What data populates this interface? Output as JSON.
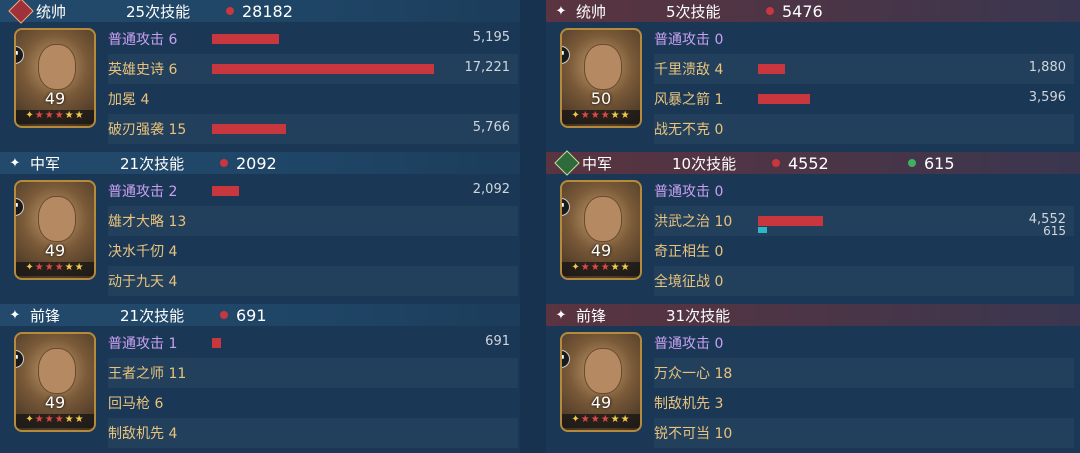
{
  "colors": {
    "damage": "#c8363e",
    "heal": "#2fb6c6",
    "skill_name": "#e9c37c",
    "normal_attack": "#c9a0f0"
  },
  "left": {
    "groups": [
      {
        "role": "统帅",
        "role_icon": "diamond-badge-icon",
        "skills_count": "25次技能",
        "damage": "28182",
        "level": "49",
        "rows": [
          {
            "name": "普通攻击",
            "count": "6",
            "dmg": 5195,
            "dmg_label": "5,195"
          },
          {
            "name": "英雄史诗",
            "count": "6",
            "dmg": 17221,
            "dmg_label": "17,221"
          },
          {
            "name": "加冕",
            "count": "4",
            "dmg": 0,
            "dmg_label": ""
          },
          {
            "name": "破刃强袭",
            "count": "15",
            "dmg": 5766,
            "dmg_label": "5,766"
          }
        ]
      },
      {
        "role": "中军",
        "role_icon": "sparkle-icon",
        "skills_count": "21次技能",
        "damage": "2092",
        "level": "49",
        "rows": [
          {
            "name": "普通攻击",
            "count": "2",
            "dmg": 2092,
            "dmg_label": "2,092"
          },
          {
            "name": "雄才大略",
            "count": "13",
            "dmg": 0,
            "dmg_label": ""
          },
          {
            "name": "决水千仞",
            "count": "4",
            "dmg": 0,
            "dmg_label": ""
          },
          {
            "name": "动于九天",
            "count": "4",
            "dmg": 0,
            "dmg_label": ""
          }
        ]
      },
      {
        "role": "前锋",
        "role_icon": "sparkle-icon",
        "skills_count": "21次技能",
        "damage": "691",
        "level": "49",
        "rows": [
          {
            "name": "普通攻击",
            "count": "1",
            "dmg": 691,
            "dmg_label": "691"
          },
          {
            "name": "王者之师",
            "count": "11",
            "dmg": 0,
            "dmg_label": ""
          },
          {
            "name": "回马枪",
            "count": "6",
            "dmg": 0,
            "dmg_label": ""
          },
          {
            "name": "制敌机先",
            "count": "4",
            "dmg": 0,
            "dmg_label": ""
          }
        ]
      }
    ]
  },
  "right": {
    "groups": [
      {
        "role": "统帅",
        "role_icon": "sparkle-icon",
        "skills_count": "5次技能",
        "damage": "5476",
        "level": "50",
        "rows": [
          {
            "name": "普通攻击",
            "count": "0",
            "dmg": 0,
            "dmg_label": ""
          },
          {
            "name": "千里溃敌",
            "count": "4",
            "dmg": 1880,
            "dmg_label": "1,880"
          },
          {
            "name": "风暴之箭",
            "count": "1",
            "dmg": 3596,
            "dmg_label": "3,596"
          },
          {
            "name": "战无不克",
            "count": "0",
            "dmg": 0,
            "dmg_label": ""
          }
        ]
      },
      {
        "role": "中军",
        "role_icon": "heart-badge-icon",
        "skills_count": "10次技能",
        "damage": "4552",
        "heal": "615",
        "level": "49",
        "rows": [
          {
            "name": "普通攻击",
            "count": "0",
            "dmg": 0,
            "dmg_label": ""
          },
          {
            "name": "洪武之治",
            "count": "10",
            "dmg": 4552,
            "dmg_label": "4,552",
            "heal": 615,
            "heal_label": "615"
          },
          {
            "name": "奇正相生",
            "count": "0",
            "dmg": 0,
            "dmg_label": ""
          },
          {
            "name": "全境征战",
            "count": "0",
            "dmg": 0,
            "dmg_label": ""
          }
        ]
      },
      {
        "role": "前锋",
        "role_icon": "sparkle-icon",
        "skills_count": "31次技能",
        "damage": "",
        "level": "49",
        "rows": [
          {
            "name": "普通攻击",
            "count": "0",
            "dmg": 0,
            "dmg_label": ""
          },
          {
            "name": "万众一心",
            "count": "18",
            "dmg": 0,
            "dmg_label": ""
          },
          {
            "name": "制敌机先",
            "count": "3",
            "dmg": 0,
            "dmg_label": ""
          },
          {
            "name": "锐不可当",
            "count": "10",
            "dmg": 0,
            "dmg_label": ""
          }
        ]
      }
    ]
  }
}
